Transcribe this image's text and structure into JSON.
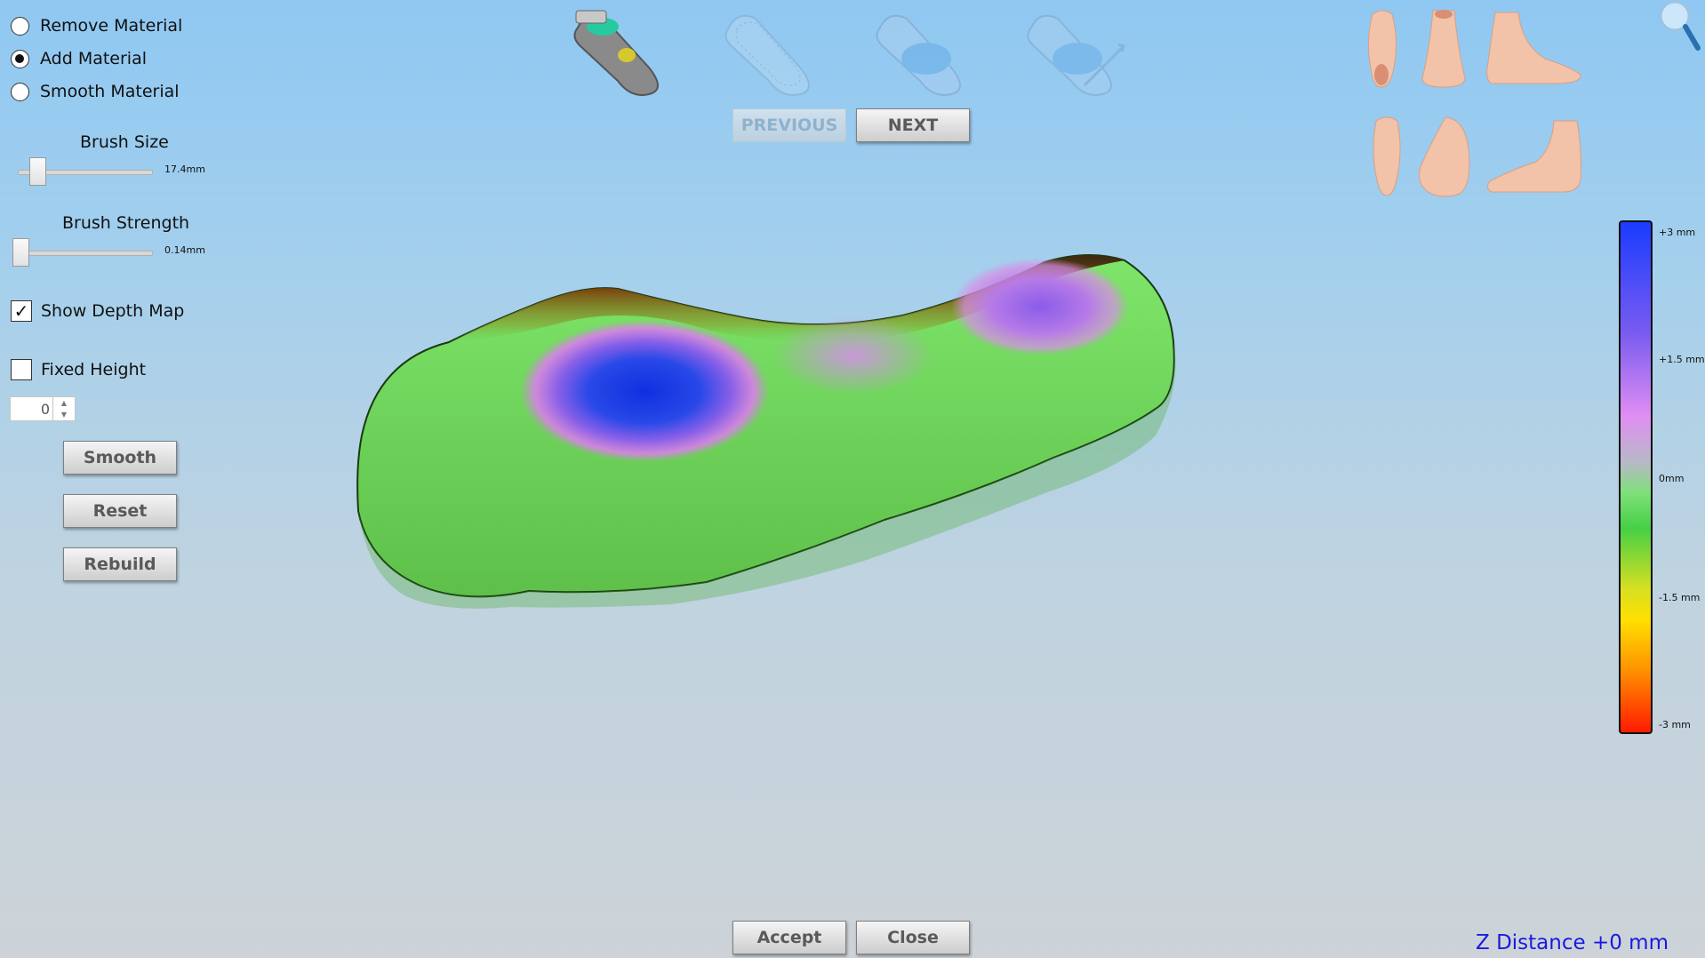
{
  "tools": {
    "remove_material": "Remove Material",
    "add_material": "Add Material",
    "smooth_material": "Smooth Material",
    "selected": "add_material"
  },
  "brush_size": {
    "label": "Brush Size",
    "value": "17.4mm"
  },
  "brush_strength": {
    "label": "Brush Strength",
    "value": "0.14mm"
  },
  "show_depth_map": {
    "label": "Show Depth Map",
    "checked": true
  },
  "fixed_height": {
    "label": "Fixed Height",
    "checked": false,
    "value": "0"
  },
  "buttons": {
    "smooth": "Smooth",
    "reset": "Reset",
    "rebuild": "Rebuild",
    "previous": "PREVIOUS",
    "next": "NEXT",
    "accept": "Accept",
    "close": "Close"
  },
  "legend": {
    "ticks": [
      "+3 mm",
      "+1.5 mm",
      "0mm",
      "-1.5 mm",
      "-3 mm"
    ]
  },
  "status": {
    "z_distance": "Z Distance +0 mm"
  },
  "colors": {
    "depth_high": "#1a3cff",
    "depth_mid_high": "#e08ef2",
    "depth_zero": "#7fe07a",
    "depth_mid_low": "#ffe000",
    "depth_low": "#ff1a00",
    "z_distance_text": "#1a1adf"
  },
  "icons": {
    "step_thumbnails": [
      "insole-depthmap-step-icon",
      "insole-outline-step-icon",
      "insole-shape-step-icon",
      "insole-resize-step-icon"
    ],
    "view_presets": [
      "foot-bottom-view-icon",
      "foot-front-view-icon",
      "foot-side-view-icon",
      "foot-top-view-icon",
      "foot-back-view-icon",
      "foot-medial-view-icon"
    ],
    "zoom": "magnifier-icon"
  }
}
